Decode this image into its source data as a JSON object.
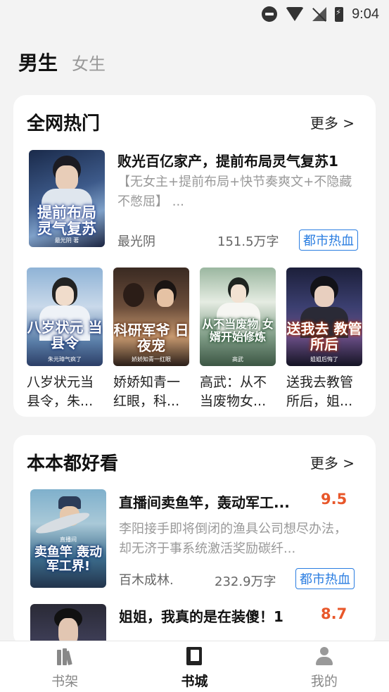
{
  "status_bar": {
    "time": "9:04",
    "icons": [
      "dnd-icon",
      "wifi-icon",
      "no-signal-icon",
      "battery-charging-icon"
    ]
  },
  "gender_tabs": {
    "male": "男生",
    "female": "女生",
    "selected": "男生"
  },
  "hot_section": {
    "title": "全网热门",
    "more": "更多 >",
    "featured": {
      "title": "败光百亿家产，提前布局灵气复苏1",
      "desc": "【无女主+提前布局+快节奏爽文+不隐藏不憋屈】 ...",
      "author": "最光阴",
      "words": "151.5万字",
      "tag": "都市热血",
      "cover_text": "提前布局 灵气复苏",
      "cover_author": "最光阴 著"
    },
    "grid": [
      {
        "title": "八岁状元当县令，朱...",
        "cover_text": "八岁状元 当县令",
        "cover_author": "朱元璋气疯了"
      },
      {
        "title": "娇娇知青一红眼，科...",
        "cover_text": "科研军爷 日夜宠",
        "cover_author": "娇娇知青一红眼"
      },
      {
        "title": "高武：从不当废物女...",
        "cover_text": "从不当废物 女婿开始修炼",
        "cover_author": "高武"
      },
      {
        "title": "送我去教管所后，姐...",
        "cover_text": "送我去 教管所后",
        "cover_author": "姐姐后悔了"
      }
    ]
  },
  "good_section": {
    "title": "本本都好看",
    "more": "更多 >",
    "books": [
      {
        "title": "直播间卖鱼竿，轰动军工...",
        "score": "9.5",
        "desc": "李阳接手即将倒闭的渔具公司想尽办法，却无济于事系统激活奖励碳纤...",
        "author": "百木成林.",
        "words": "232.9万字",
        "tag": "都市热血",
        "cover_text": "卖鱼竿 轰动军工界!",
        "cover_author": "直播间"
      },
      {
        "title": "姐姐，我真的是在装傻！1",
        "score": "8.7"
      }
    ]
  },
  "bottom_nav": [
    {
      "label": "书架",
      "icon": "bookshelf-icon",
      "active": false
    },
    {
      "label": "书城",
      "icon": "book-icon",
      "active": true
    },
    {
      "label": "我的",
      "icon": "user-icon",
      "active": false
    }
  ],
  "colors": {
    "accent_blue": "#2a7de1",
    "score_orange": "#e8572a",
    "background": "#f3f3f3"
  }
}
